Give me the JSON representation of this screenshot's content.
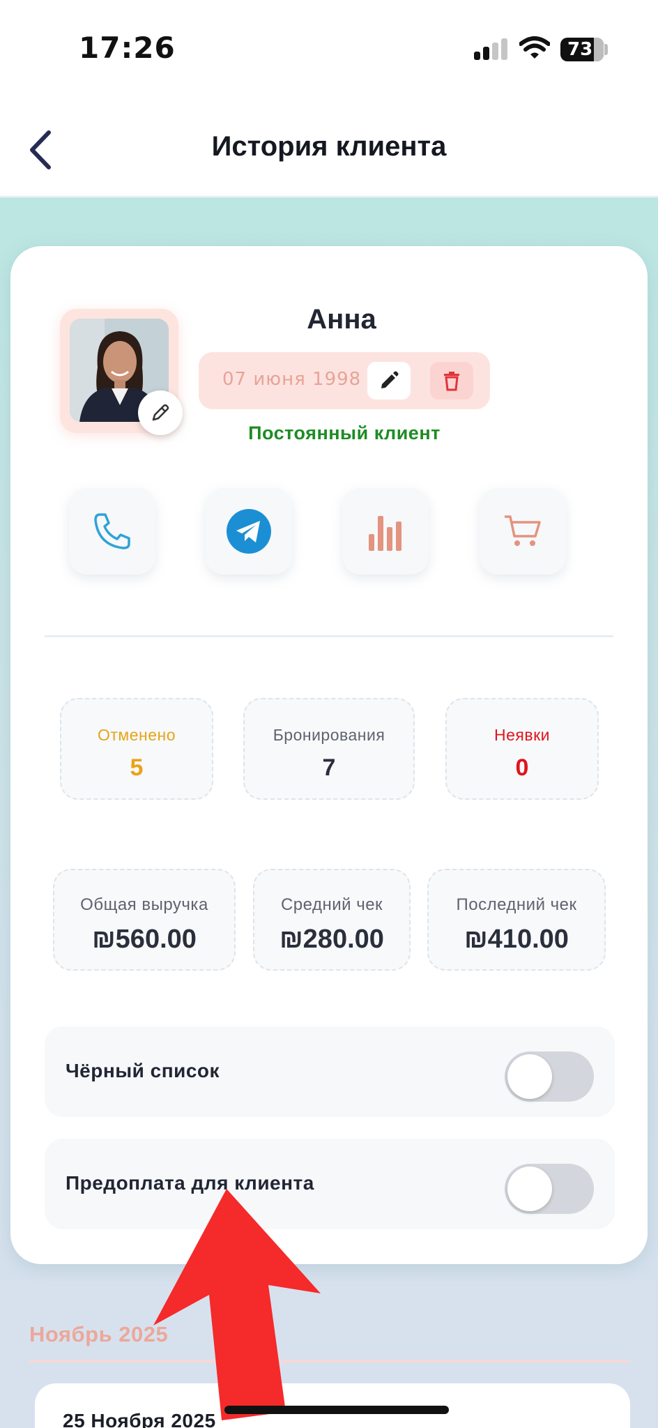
{
  "status_bar": {
    "time": "17:26",
    "battery": "73"
  },
  "nav": {
    "title": "История клиента"
  },
  "client": {
    "name": "Анна",
    "birth_date": "07 июня 1998",
    "status": "Постоянный клиент"
  },
  "actions": [
    {
      "icon": "phone-icon"
    },
    {
      "icon": "telegram-icon"
    },
    {
      "icon": "bar-chart-icon"
    },
    {
      "icon": "cart-icon"
    }
  ],
  "stats": [
    {
      "label": "Отменено",
      "value": "5",
      "color": "#e8a317"
    },
    {
      "label": "Бронирования",
      "value": "7",
      "color": "#2a2f3b"
    },
    {
      "label": "Неявки",
      "value": "0",
      "color": "#e0141e"
    }
  ],
  "revenue": [
    {
      "label": "Общая выручка",
      "value": "₪560.00"
    },
    {
      "label": "Средний чек",
      "value": "₪280.00"
    },
    {
      "label": "Последний чек",
      "value": "₪410.00"
    }
  ],
  "toggles": [
    {
      "label": "Чёрный список",
      "on": false
    },
    {
      "label": "Предоплата для клиента",
      "on": false
    }
  ],
  "history": {
    "month": "Ноябрь 2025",
    "day": "25 Ноября 2025"
  },
  "colors": {
    "accent_peach": "#eba89a",
    "status_green": "#1e8c24",
    "annotation_arrow": "#f52a2a",
    "background_teal": "#bbe6e2"
  }
}
